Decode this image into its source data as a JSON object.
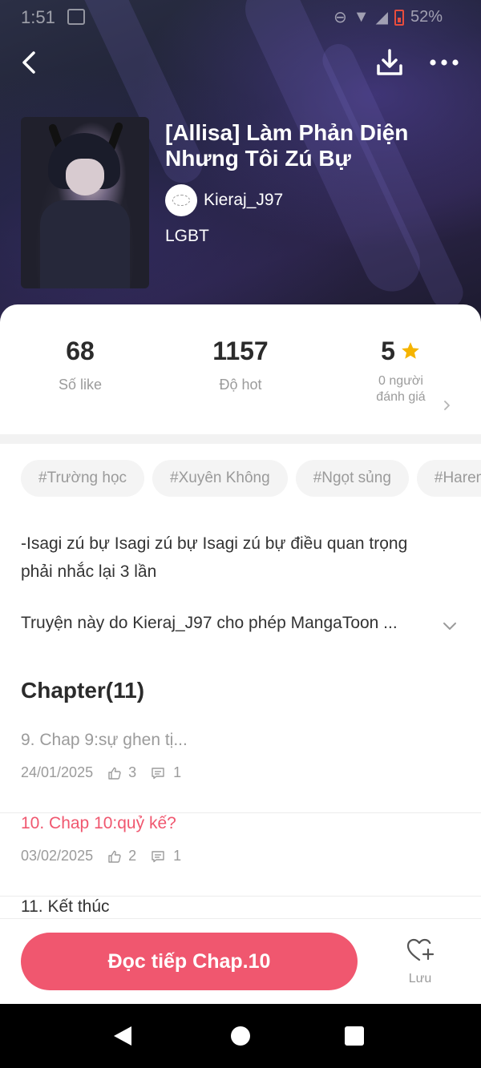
{
  "status_bar": {
    "time": "1:51",
    "battery": "52%"
  },
  "manga": {
    "title": "[Allisa] Làm Phản Diện Nhưng Tôi Zú Bự",
    "author": "Kieraj_J97",
    "genre": "LGBT"
  },
  "stats": {
    "likes": {
      "value": "68",
      "label": "Số like"
    },
    "hot": {
      "value": "1157",
      "label": "Độ hot"
    },
    "rating": {
      "value": "5",
      "label_line1": "0 người",
      "label_line2": "đánh giá"
    }
  },
  "tags": [
    "#Trường học",
    "#Xuyên Không",
    "#Ngọt sủng",
    "#Harem"
  ],
  "description": "-Isagi zú bự Isagi zú bự Isagi zú bự điều quan trọng phải nhắc lại 3 lần",
  "permission": "Truyện này do Kieraj_J97 cho phép MangaToon ...",
  "chapters": {
    "heading": "Chapter(11)",
    "items": [
      {
        "title": "9. Chap 9:sự ghen tị...",
        "date": "24/01/2025",
        "likes": "3",
        "comments": "1"
      },
      {
        "title": "10. Chap 10:quỷ kế?",
        "date": "03/02/2025",
        "likes": "2",
        "comments": "1"
      },
      {
        "title": "11. Kết thúc"
      }
    ]
  },
  "actions": {
    "continue_label": "Đọc tiếp Chap.10",
    "save_label": "Lưu"
  },
  "colors": {
    "accent": "#f0576f",
    "star": "#f5b400",
    "muted": "#9b9b9b",
    "read_chapter": "#9b9b9b",
    "current_chapter": "#f0576f",
    "unread_chapter": "#333333"
  },
  "icons": [
    "back-icon",
    "download-icon",
    "more-icon",
    "star-icon",
    "chevron-right-icon",
    "chevron-down-icon",
    "thumbs-up-icon",
    "comment-icon",
    "heart-plus-icon"
  ]
}
